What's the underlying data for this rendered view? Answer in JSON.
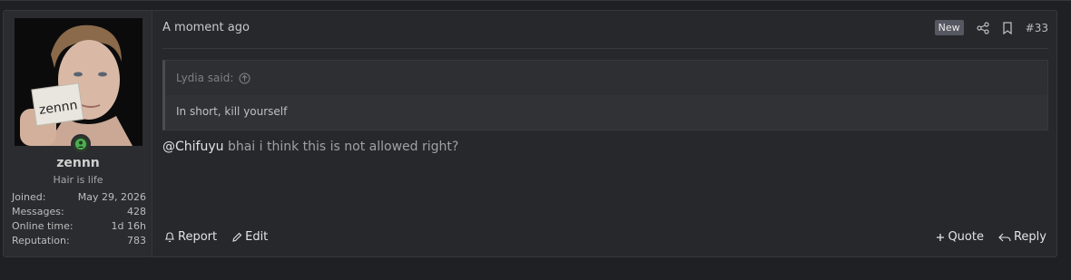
{
  "post": {
    "time": "A moment ago",
    "new_badge": "New",
    "number": "#33",
    "user": {
      "name": "zennn",
      "title": "Hair is life",
      "avatar_caption": "zennn",
      "stats": [
        {
          "label": "Joined:",
          "value": "May 29, 2026"
        },
        {
          "label": "Messages:",
          "value": "428"
        },
        {
          "label": "Online time:",
          "value": "1d 16h"
        },
        {
          "label": "Reputation:",
          "value": "783"
        }
      ]
    },
    "quote": {
      "author_line": "Lydia said:",
      "text": "In short, kill yourself"
    },
    "message": {
      "mention": "@Chifuyu",
      "text": " bhai i think this is not allowed right?"
    },
    "actions": {
      "report": "Report",
      "edit": "Edit",
      "quote": "Quote",
      "reply": "Reply"
    }
  },
  "colors": {
    "background": "#1f2023",
    "panel": "#27282c",
    "online_green": "#4caf50"
  },
  "icons": [
    "online-status-icon",
    "share-icon",
    "bookmark-icon",
    "arrow-up-circle-icon",
    "bell-icon",
    "pencil-icon",
    "plus-icon",
    "reply-arrow-icon"
  ]
}
